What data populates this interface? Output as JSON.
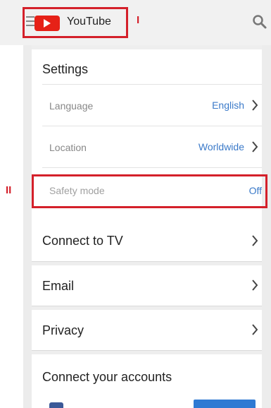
{
  "header": {
    "app_title": "YouTube",
    "annotation_label_1": "I",
    "annotation_label_2": "II"
  },
  "settings": {
    "title": "Settings",
    "rows": [
      {
        "label": "Language",
        "value": "English"
      },
      {
        "label": "Location",
        "value": "Worldwide"
      },
      {
        "label": "Safety mode",
        "value": "Off"
      }
    ]
  },
  "menu": {
    "connect_tv": "Connect to TV",
    "email": "Email",
    "privacy": "Privacy",
    "connect_accounts": "Connect your accounts"
  },
  "colors": {
    "brand": "#e62117",
    "link": "#3b7ac9",
    "annotation": "#d4202a"
  }
}
